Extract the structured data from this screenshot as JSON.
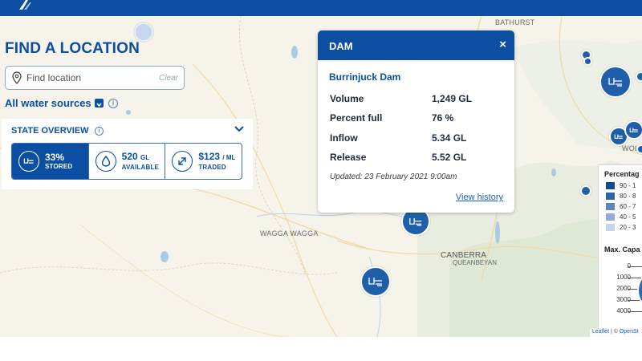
{
  "header": {
    "logo_icon": "brand-logo-icon",
    "color": "#0b4ea2"
  },
  "map": {
    "places": [
      "BATHURST",
      "WAGGA WAGGA",
      "CANBERRA",
      "QUEANBEYAN",
      "WOLLO"
    ]
  },
  "find_location": {
    "title": "FIND A LOCATION",
    "search_placeholder": "Find location",
    "clear_label": "Clear",
    "filter_label": "All water sources"
  },
  "state_overview": {
    "title": "STATE OVERVIEW",
    "stats": [
      {
        "value": "33%",
        "unit": "",
        "label": "STORED",
        "icon": "dam-icon"
      },
      {
        "value": "520",
        "unit": "GL",
        "label": "AVAILABLE",
        "icon": "water-drop-icon"
      },
      {
        "value": "$123",
        "unit": "/ ML",
        "label": "TRADED",
        "icon": "trade-arrows-icon"
      }
    ]
  },
  "popup": {
    "header": "DAM",
    "close_label": "×",
    "name": "Burrinjuck Dam",
    "rows": [
      {
        "label": "Volume",
        "value": "1,249 GL"
      },
      {
        "label": "Percent full",
        "value": "76 %"
      },
      {
        "label": "Inflow",
        "value": "5.34 GL"
      },
      {
        "label": "Release",
        "value": "5.52 GL"
      }
    ],
    "updated": "Updated: 23 February 2021 9:00am",
    "history_link": "View history"
  },
  "legend": {
    "title": "Percentag",
    "ranges": [
      {
        "label": "90 - 1",
        "color": "#0d4a9b"
      },
      {
        "label": "80 - 8",
        "color": "#2d64ad"
      },
      {
        "label": "60 - 7",
        "color": "#5b86c2"
      },
      {
        "label": "40 - 5",
        "color": "#8fadd6"
      },
      {
        "label": "20 - 3",
        "color": "#c5d5ec"
      }
    ],
    "capacity_title": "Max. Capa",
    "capacity_ticks": [
      "0",
      "1000",
      "2000",
      "3000",
      "4000"
    ]
  },
  "attribution": {
    "leaflet": "Leaflet",
    "separator": " | © ",
    "osm": "OpenSt"
  }
}
